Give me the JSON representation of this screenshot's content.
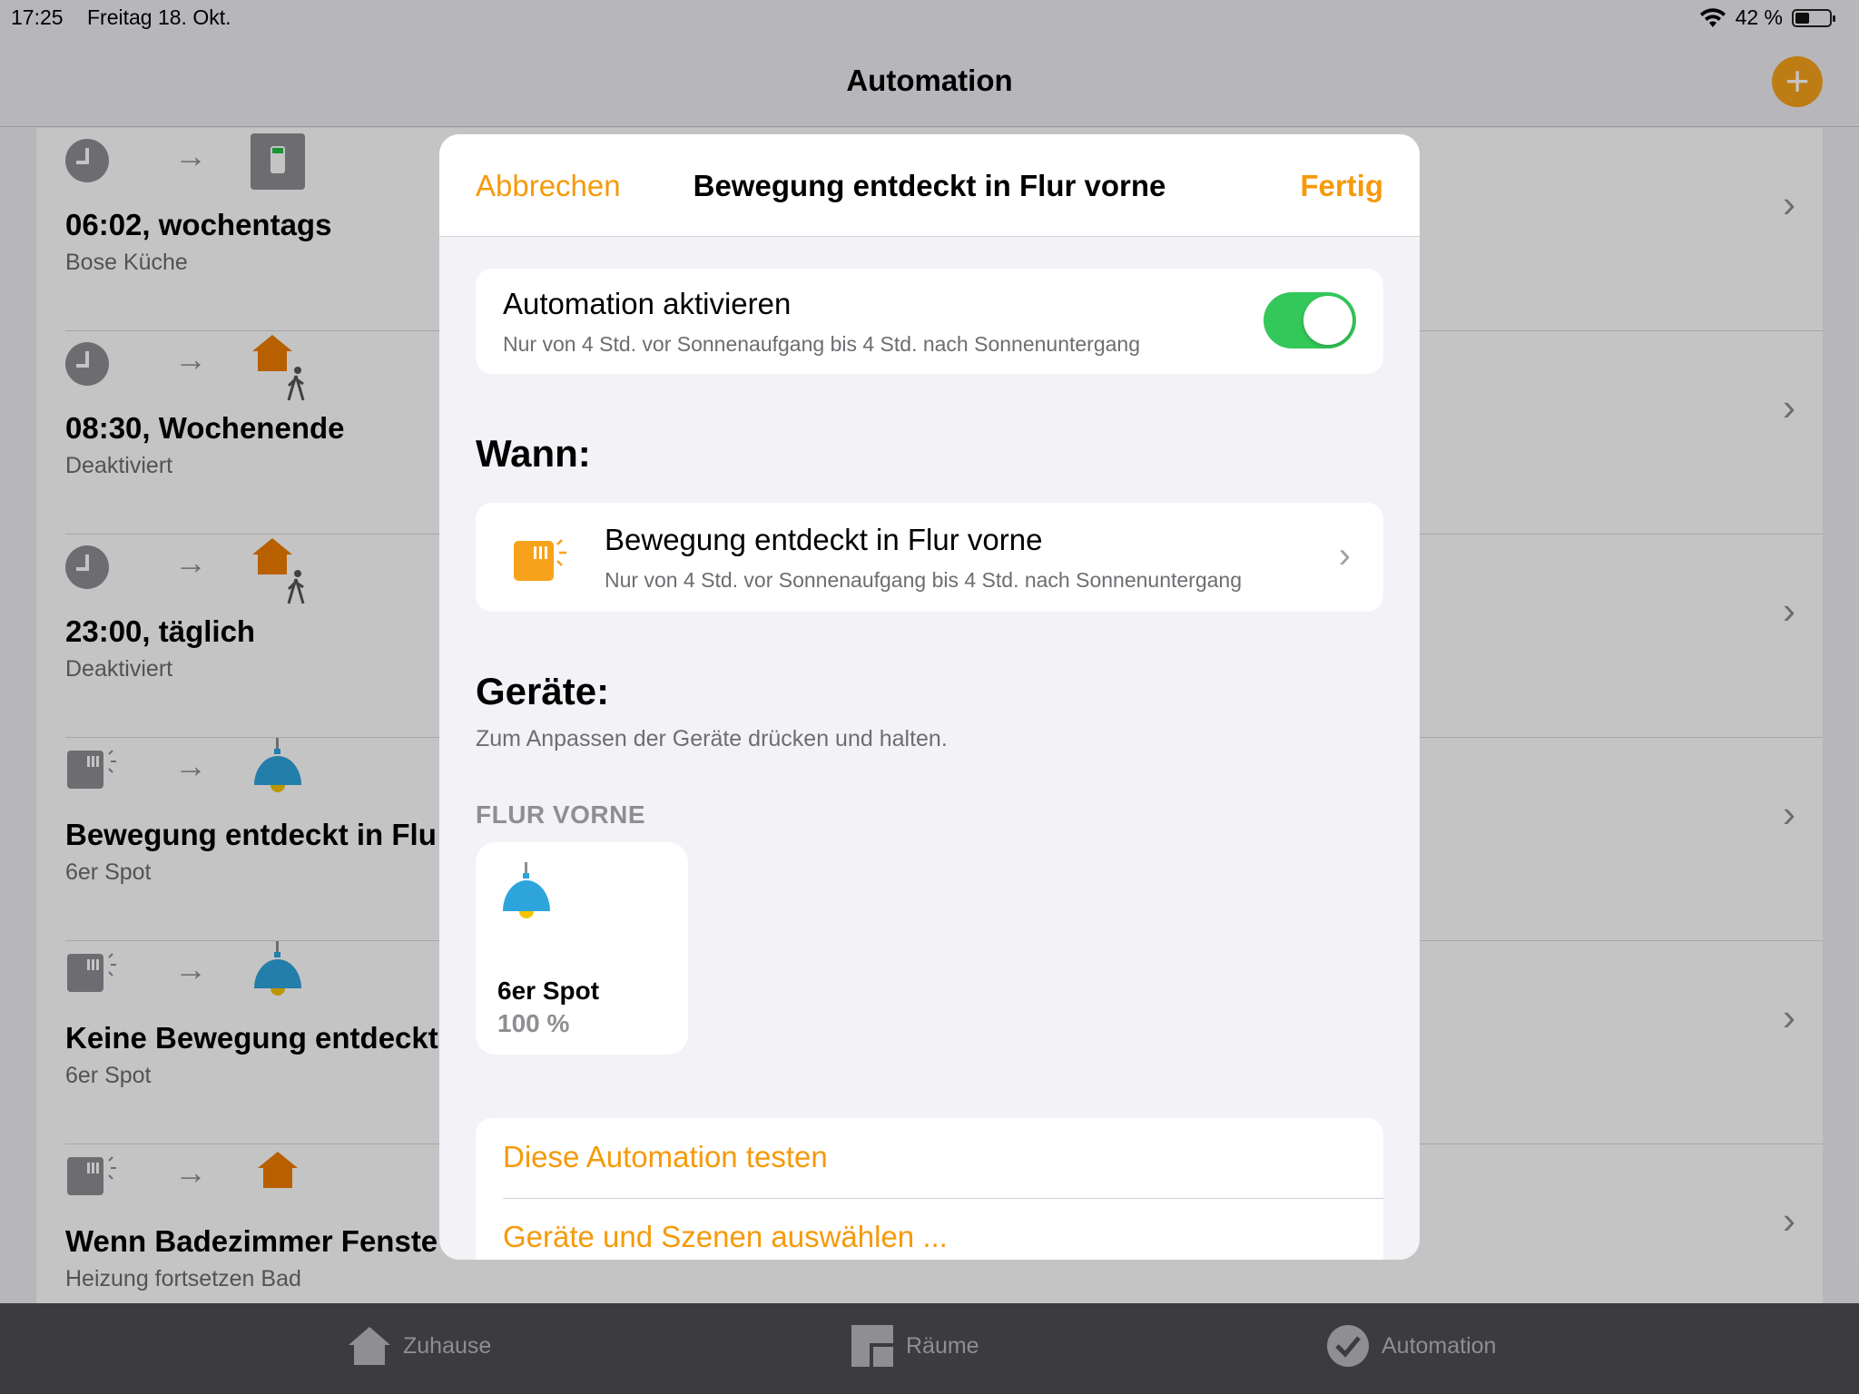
{
  "status_bar": {
    "time": "17:25",
    "date": "Freitag 18. Okt.",
    "battery": "42 %",
    "battery_level": 0.42
  },
  "navbar": {
    "title": "Automation",
    "add_label": "+"
  },
  "automations": [
    {
      "title": "06:02, wochentags",
      "subtitle": "Bose Küche",
      "trigger_icon": "clock-icon",
      "action_icon": "switch-icon"
    },
    {
      "title": "08:30, Wochenende",
      "subtitle": "Deaktiviert",
      "trigger_icon": "clock-icon",
      "action_icon": "house-person-icon"
    },
    {
      "title": "23:00, täglich",
      "subtitle": "Deaktiviert",
      "trigger_icon": "clock-icon",
      "action_icon": "house-person-icon"
    },
    {
      "title": "Bewegung entdeckt in Flu",
      "subtitle": "6er Spot",
      "trigger_icon": "motion-sensor-icon",
      "action_icon": "lamp-icon"
    },
    {
      "title": "Keine Bewegung entdeckt",
      "subtitle": "6er Spot",
      "trigger_icon": "motion-sensor-icon",
      "action_icon": "lamp-icon"
    },
    {
      "title": "Wenn Badezimmer Fenste",
      "subtitle": "Heizung fortsetzen Bad",
      "trigger_icon": "motion-sensor-icon",
      "action_icon": "house-icon"
    }
  ],
  "arrow_glyph": "→",
  "chevron_glyph": "›",
  "tabbar": {
    "tabs": [
      {
        "label": "Zuhause",
        "icon": "home-icon"
      },
      {
        "label": "Räume",
        "icon": "rooms-icon"
      },
      {
        "label": "Automation",
        "icon": "automation-check-icon"
      }
    ]
  },
  "modal": {
    "cancel": "Abbrechen",
    "title": "Bewegung entdeckt in Flur vorne",
    "done": "Fertig",
    "toggle": {
      "title": "Automation aktivieren",
      "subtitle": "Nur von 4 Std. vor Sonnenaufgang bis 4 Std. nach Sonnenuntergang",
      "on": true
    },
    "when_heading": "Wann:",
    "when": {
      "title": "Bewegung entdeckt in Flur vorne",
      "subtitle": "Nur von 4 Std. vor Sonnenaufgang bis 4 Std. nach Sonnenuntergang",
      "icon": "motion-sensor-icon"
    },
    "devices_heading": "Geräte:",
    "devices_hint": "Zum Anpassen der Geräte drücken und halten.",
    "room_label": "FLUR VORNE",
    "device": {
      "name": "6er Spot",
      "value": "100 %",
      "icon": "lamp-icon"
    },
    "actions": [
      "Diese Automation testen",
      "Geräte und Szenen auswählen ..."
    ]
  },
  "colors": {
    "accent": "#f59a0b",
    "toggle_on": "#34c759",
    "lamp_blue": "#2ea4dc",
    "house_orange": "#f07d00"
  }
}
